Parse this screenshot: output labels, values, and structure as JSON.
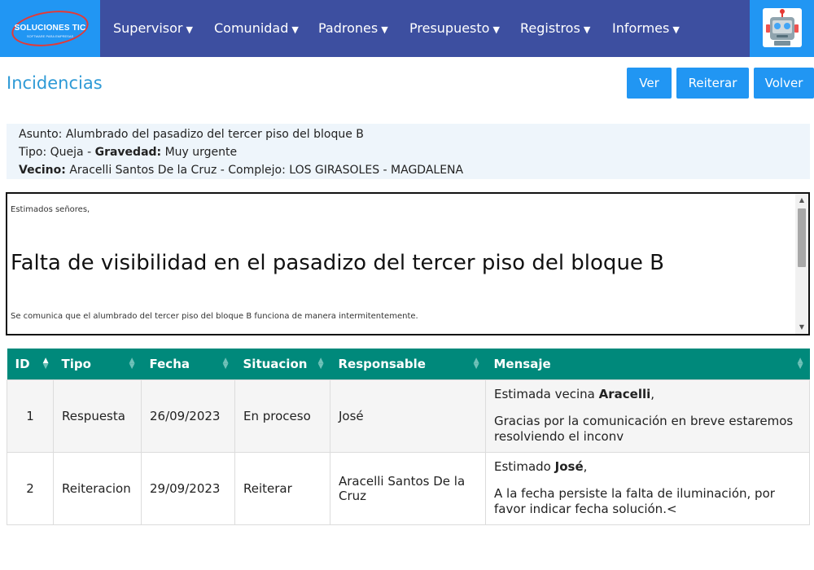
{
  "brand": {
    "name": "SOLUCIONES TIC",
    "tagline": "SOFTWARE PARA EMPRESAS"
  },
  "nav": {
    "items": [
      {
        "label": "Supervisor"
      },
      {
        "label": "Comunidad"
      },
      {
        "label": "Padrones"
      },
      {
        "label": "Presupuesto"
      },
      {
        "label": "Registros"
      },
      {
        "label": "Informes"
      }
    ],
    "caret_icon": "caret-down-icon",
    "avatar_icon": "robot-avatar-icon"
  },
  "page": {
    "title": "Incidencias",
    "buttons": {
      "ver": "Ver",
      "reiterar": "Reiterar",
      "volver": "Volver"
    }
  },
  "info": {
    "asunto_label": "Asunto:",
    "asunto": "Alumbrado del pasadizo del tercer piso del bloque B",
    "tipo_label": "Tipo:",
    "tipo": "Queja",
    "gravedad_label": "Gravedad:",
    "gravedad": "Muy urgente",
    "vecino_label": "Vecino:",
    "vecino": "Aracelli Santos De la Cruz",
    "complejo_label": "Complejo:",
    "complejo": "LOS GIRASOLES - MAGDALENA"
  },
  "message": {
    "greeting": "Estimados señores,",
    "heading": "Falta de visibilidad en el pasadizo del tercer piso del bloque B",
    "body": "Se comunica que el alumbrado del tercer piso del bloque B funciona de manera intermitentemente."
  },
  "table": {
    "headers": [
      "ID",
      "Tipo",
      "Fecha",
      "Situacion",
      "Responsable",
      "Mensaje"
    ],
    "rows": [
      {
        "id": "1",
        "tipo": "Respuesta",
        "fecha": "26/09/2023",
        "situacion": "En proceso",
        "responsable": "José",
        "greet_prefix": "Estimada vecina ",
        "greet_name": "Aracelli",
        "greet_suffix": ",",
        "text": "Gracias por la comunicación en breve estaremos resolviendo el inconv"
      },
      {
        "id": "2",
        "tipo": "Reiteracion",
        "fecha": "29/09/2023",
        "situacion": "Reiterar",
        "responsable": "Aracelli Santos De la Cruz",
        "greet_prefix": "Estimado ",
        "greet_name": "José",
        "greet_suffix": ",",
        "text": "A la fecha persiste la falta de iluminación, por favor indicar fecha solución.<"
      }
    ]
  },
  "colors": {
    "navbar": "#3d4fa0",
    "accent": "#2196f3",
    "title": "#2e9ad6",
    "table_header": "#00897b",
    "info_bg": "#eef5fb"
  }
}
